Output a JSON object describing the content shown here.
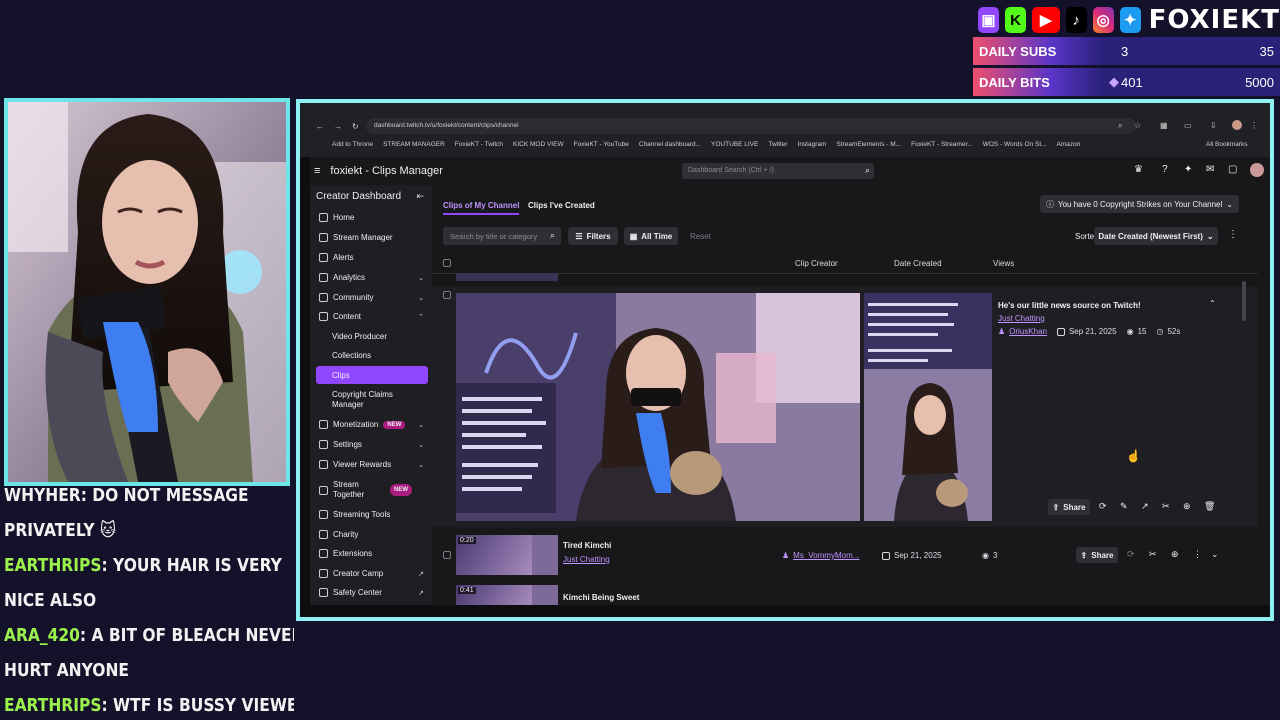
{
  "overlay": {
    "icons": [
      {
        "name": "twitch-icon",
        "glyph": "▣",
        "color": "#9146ff"
      },
      {
        "name": "kick-icon",
        "glyph": "K",
        "color": "#53fc18"
      },
      {
        "name": "youtube-icon",
        "glyph": "▶",
        "color": "#ff0000"
      },
      {
        "name": "tiktok-icon",
        "glyph": "♪",
        "color": "#000000"
      },
      {
        "name": "instagram-icon",
        "glyph": "◎",
        "color": "#dd2a7b"
      },
      {
        "name": "twitter-icon",
        "glyph": "✦",
        "color": "#1d9bf0"
      }
    ],
    "brand": "FOXIEKT",
    "stats": [
      {
        "label": "DAILY SUBS",
        "current": "3",
        "goal": "35"
      },
      {
        "label": "DAILY BITS",
        "current": "401",
        "goal": "5000"
      }
    ]
  },
  "chat": {
    "lines": [
      {
        "user": "",
        "text": "WHYHER: DO NOT MESSAGE"
      },
      {
        "user": "",
        "text": "PRIVATELY 🐱"
      },
      {
        "user": "EARTHRIPS",
        "text": ": YOUR HAIR IS VERY"
      },
      {
        "user": "",
        "text": "NICE ALSO"
      },
      {
        "user": "ARA_420",
        "text": ": A BIT OF BLEACH NEVER"
      },
      {
        "user": "",
        "text": "HURT ANYONE"
      },
      {
        "user": "EARTHRIPS",
        "text": ": WTF IS BUSSY VIEWER"
      }
    ]
  },
  "browser": {
    "url": "dashboard.twitch.tv/u/foxiekt/content/clips/channel",
    "bookmarks": [
      "Add to Throne",
      "STREAM MANAGER",
      "FoxieKT - Twitch",
      "KICK MOD VIEW",
      "FoxieKT - YouTube",
      "Channel dashboard...",
      "YOUTUBE LIVE",
      "Twitter",
      "Instagram",
      "StreamElements - M...",
      "FoxieKT - Streamer...",
      "WOS - Words On St...",
      "Amazon"
    ],
    "all_bookmarks": "All Bookmarks"
  },
  "twitch": {
    "page_title": "foxiekt - Clips Manager",
    "search_placeholder": "Dashboard Search (Ctrl + /)",
    "sidebar": {
      "title": "Creator Dashboard",
      "items": [
        {
          "label": "Home"
        },
        {
          "label": "Stream Manager"
        },
        {
          "label": "Alerts"
        },
        {
          "label": "Analytics"
        },
        {
          "label": "Community"
        },
        {
          "label": "Content"
        },
        {
          "label": "Video Producer"
        },
        {
          "label": "Collections"
        },
        {
          "label": "Clips"
        },
        {
          "label": "Copyright Claims Manager"
        },
        {
          "label": "Monetization",
          "badge": "NEW"
        },
        {
          "label": "Settings"
        },
        {
          "label": "Viewer Rewards"
        },
        {
          "label": "Stream Together",
          "badge": "NEW"
        },
        {
          "label": "Streaming Tools"
        },
        {
          "label": "Charity"
        },
        {
          "label": "Extensions"
        },
        {
          "label": "Creator Camp"
        },
        {
          "label": "Safety Center"
        }
      ]
    },
    "tabs": [
      "Clips of My Channel",
      "Clips I've Created"
    ],
    "copyright_notice": "You have 0 Copyright Strikes on Your Channel",
    "search_clips_placeholder": "Search by title or category",
    "filters_label": "Filters",
    "all_time_label": "All Time",
    "reset_label": "Reset",
    "sorted_by_label": "Sorted By",
    "sort_value": "Date Created (Newest First)",
    "columns": [
      "Clip Creator",
      "Date Created",
      "Views"
    ],
    "expanded_clip": {
      "title": "He's our little news source on Twitch!",
      "category": "Just Chatting",
      "creator": "OriusKhan",
      "date": "Sep 21, 2025",
      "views": "15",
      "duration": "52s",
      "share_label": "Share"
    },
    "rows": [
      {
        "duration": "0:20",
        "title": "Tired Kimchi",
        "category": "Just Chatting",
        "creator": "Ms_VommyMom...",
        "date": "Sep 21, 2025",
        "views": "3",
        "share_label": "Share"
      },
      {
        "duration": "0:41",
        "title": "Kimchi Being Sweet"
      }
    ]
  },
  "colors": {
    "accent": "#9146ff",
    "frame": "#8ef0f3",
    "cam_border": "#6ee5e9",
    "chat_user": "#9cf24c"
  }
}
